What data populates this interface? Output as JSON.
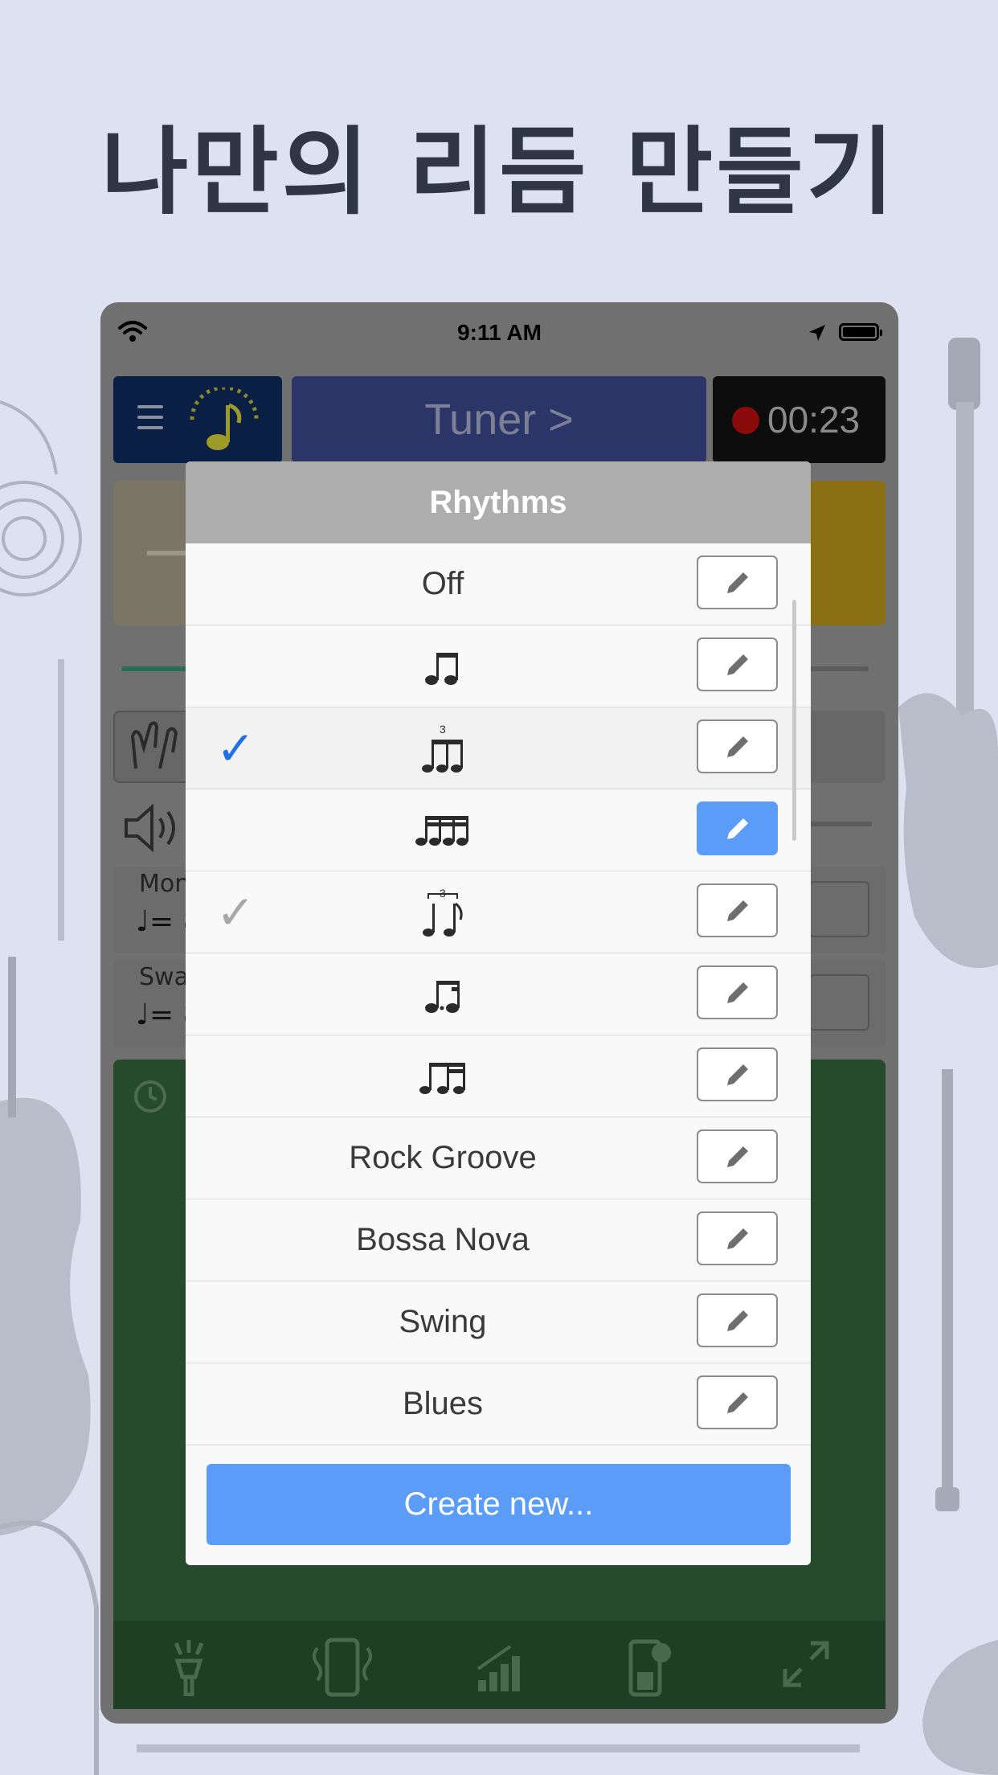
{
  "headline": "나만의 리듬 만들기",
  "statusbar": {
    "time": "9:11 AM"
  },
  "toolbar": {
    "tuner_label": "Tuner >",
    "timer": "00:23"
  },
  "background_panel": {
    "mon_label": "Mon",
    "mon_tempo": "♩= 8",
    "swa_label": "Swa",
    "swa_tempo": "♩= 8"
  },
  "modal": {
    "title": "Rhythms",
    "rows": [
      {
        "label": "Off",
        "check": "",
        "edit_active": false
      },
      {
        "label": "",
        "icon": "eighth-notes-icon",
        "check": "",
        "edit_active": false
      },
      {
        "label": "",
        "icon": "triplet-icon",
        "check": "✓",
        "check_color": "#1f6fe8",
        "edit_active": false
      },
      {
        "label": "",
        "icon": "sixteenth-notes-icon",
        "check": "",
        "edit_active": true
      },
      {
        "label": "",
        "icon": "swing-triplet-icon",
        "check": "✓",
        "check_color": "#a8a8a8",
        "edit_active": false
      },
      {
        "label": "",
        "icon": "dotted-eighth-sixteenth-icon",
        "check": "",
        "edit_active": false
      },
      {
        "label": "",
        "icon": "eighth-two-sixteenths-icon",
        "check": "",
        "edit_active": false
      },
      {
        "label": "Rock Groove",
        "check": "",
        "edit_active": false
      },
      {
        "label": "Bossa Nova",
        "check": "",
        "edit_active": false
      },
      {
        "label": "Swing",
        "check": "",
        "edit_active": false
      },
      {
        "label": "Blues",
        "check": "",
        "edit_active": false
      }
    ],
    "create_label": "Create new..."
  },
  "colors": {
    "accent": "#5a9cf7",
    "check_active": "#1f6fe8",
    "check_inactive": "#a8a8a8"
  }
}
